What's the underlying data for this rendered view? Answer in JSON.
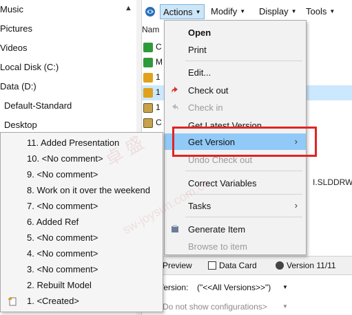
{
  "folders": [
    "Music",
    "Pictures",
    "Videos",
    "Local Disk (C:)",
    "Data (D:)",
    "Default-Standard",
    "Desktop"
  ],
  "toolbar": {
    "actions": "Actions",
    "modify": "Modify",
    "display": "Display",
    "tools": "Tools"
  },
  "file_list": {
    "name_header": "Nam",
    "row_labels": [
      "C",
      "M",
      "1",
      "1",
      "1",
      "C"
    ],
    "sldd_text": "I.SLDDRW"
  },
  "actions_menu": {
    "open": "Open",
    "print": "Print",
    "edit": "Edit...",
    "check_out": "Check out",
    "check_in": "Check in",
    "get_latest": "Get Latest Version",
    "get_version": "Get Version",
    "undo_check_out": "Undo Check out",
    "correct_variables": "Correct Variables",
    "tasks": "Tasks",
    "generate_item": "Generate Item",
    "browse_to_item": "Browse to item"
  },
  "version_submenu": [
    "11. Added Presentation",
    "10. <No comment>",
    "9. <No comment>",
    "8. Work on it over the weekend",
    "7. <No comment>",
    "6. Added Ref",
    "5. <No comment>",
    "4. <No comment>",
    "3. <No comment>",
    "2. Rebuilt Model",
    "1. <Created>"
  ],
  "bottom_tabs": {
    "preview": "Preview",
    "data_card": "Data Card",
    "version": "Version 11/11"
  },
  "version_field": {
    "label": "Version:",
    "value": "(\"<<All Versions>>\")"
  },
  "config_field": {
    "value": "Do not show configurations>"
  },
  "watermark": {
    "line1": "卓 盛",
    "line2": "sw-joysun.com.cn"
  },
  "colors": {
    "highlight": "#91c9f7",
    "red_box": "#e02424",
    "toolbar_active": "#cde6f7"
  }
}
